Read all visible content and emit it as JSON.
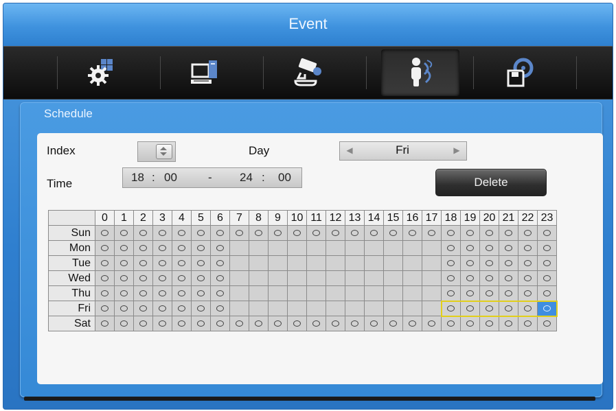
{
  "window": {
    "title": "Event"
  },
  "toolbar": {
    "tabs": [
      {
        "icon": "system-settings-icon",
        "active": false
      },
      {
        "icon": "network-computer-icon",
        "active": false
      },
      {
        "icon": "camera-icon",
        "active": false
      },
      {
        "icon": "event-person-icon",
        "active": true
      },
      {
        "icon": "backup-disk-icon",
        "active": false
      }
    ]
  },
  "panel": {
    "title": "Schedule",
    "index_label": "Index",
    "index_value": "",
    "day_label": "Day",
    "day_value": "Fri",
    "day_prev": "◀",
    "day_next": "▶",
    "time_label": "Time",
    "time": {
      "start_hour": "18",
      "start_min": "00",
      "end_hour": "24",
      "end_min": "00",
      "colon": ":",
      "dash": "-"
    },
    "delete_label": "Delete"
  },
  "schedule": {
    "hours": [
      "0",
      "1",
      "2",
      "3",
      "4",
      "5",
      "6",
      "7",
      "8",
      "9",
      "10",
      "11",
      "12",
      "13",
      "14",
      "15",
      "16",
      "17",
      "18",
      "19",
      "20",
      "21",
      "22",
      "23"
    ],
    "mark": "O",
    "rows": [
      {
        "day": "Sun",
        "on": [
          0,
          1,
          2,
          3,
          4,
          5,
          6,
          7,
          8,
          9,
          10,
          11,
          12,
          13,
          14,
          15,
          16,
          17,
          18,
          19,
          20,
          21,
          22,
          23
        ]
      },
      {
        "day": "Mon",
        "on": [
          0,
          1,
          2,
          3,
          4,
          5,
          6,
          18,
          19,
          20,
          21,
          22,
          23
        ]
      },
      {
        "day": "Tue",
        "on": [
          0,
          1,
          2,
          3,
          4,
          5,
          6,
          18,
          19,
          20,
          21,
          22,
          23
        ]
      },
      {
        "day": "Wed",
        "on": [
          0,
          1,
          2,
          3,
          4,
          5,
          6,
          18,
          19,
          20,
          21,
          22,
          23
        ]
      },
      {
        "day": "Thu",
        "on": [
          0,
          1,
          2,
          3,
          4,
          5,
          6,
          18,
          19,
          20,
          21,
          22,
          23
        ]
      },
      {
        "day": "Fri",
        "on": [
          0,
          1,
          2,
          3,
          4,
          5,
          6,
          18,
          19,
          20,
          21,
          22,
          23
        ]
      },
      {
        "day": "Sat",
        "on": [
          0,
          1,
          2,
          3,
          4,
          5,
          6,
          7,
          8,
          9,
          10,
          11,
          12,
          13,
          14,
          15,
          16,
          17,
          18,
          19,
          20,
          21,
          22,
          23
        ]
      }
    ],
    "selection": {
      "day": "Fri",
      "from_hour": 18,
      "to_hour": 23,
      "cursor_hour": 23
    }
  },
  "colors": {
    "accent": "#3f8ee0",
    "selection": "#e2cf1a",
    "title_bar": "#3f92de",
    "toolbar": "#111111"
  }
}
